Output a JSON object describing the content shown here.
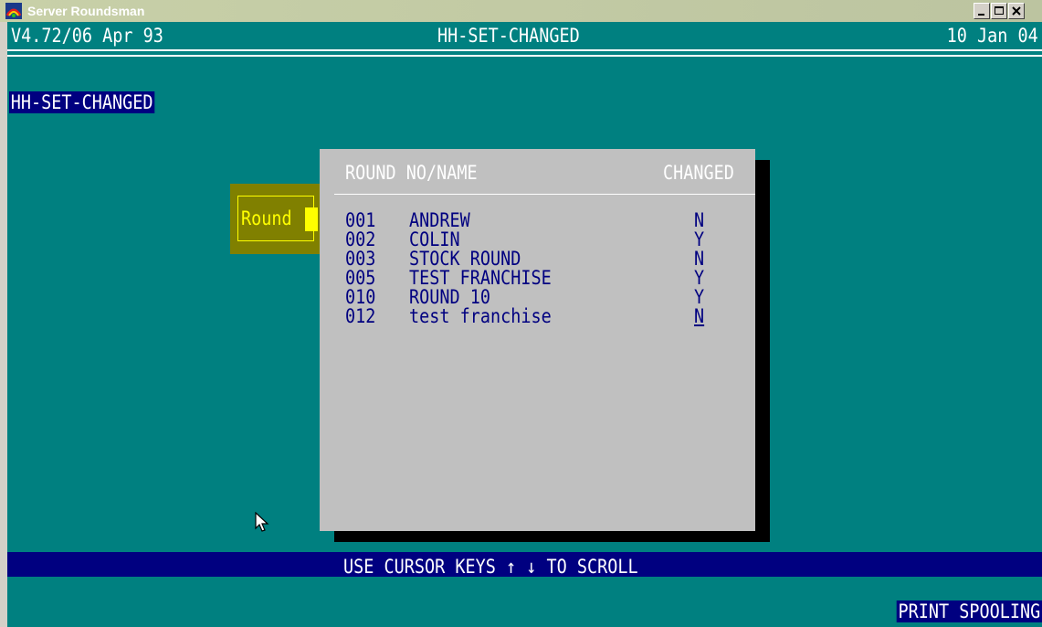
{
  "window": {
    "title": "Server Roundsman"
  },
  "header": {
    "version": "V4.72/06 Apr 93",
    "screen_name": "HH-SET-CHANGED",
    "date": "10 Jan 04"
  },
  "program_label": "HH-SET-CHANGED",
  "field": {
    "label": "Round"
  },
  "popup": {
    "col1": "ROUND NO/NAME",
    "col2": "CHANGED",
    "rows": [
      {
        "no": "001",
        "name": "ANDREW",
        "changed": "N"
      },
      {
        "no": "002",
        "name": "COLIN",
        "changed": "Y"
      },
      {
        "no": "003",
        "name": "STOCK ROUND",
        "changed": "N"
      },
      {
        "no": "005",
        "name": "TEST FRANCHISE",
        "changed": "Y"
      },
      {
        "no": "010",
        "name": "ROUND 10",
        "changed": "Y"
      },
      {
        "no": "012",
        "name": "test franchise",
        "changed": "N"
      }
    ]
  },
  "footer": {
    "hint": "USE CURSOR KEYS ↑ ↓ TO SCROLL",
    "status": "PRINT SPOOLING"
  },
  "colors": {
    "background": "#008080",
    "popup": "#c0c0c0",
    "bar": "#000080",
    "field": "#808000",
    "highlight": "#ffff00"
  }
}
